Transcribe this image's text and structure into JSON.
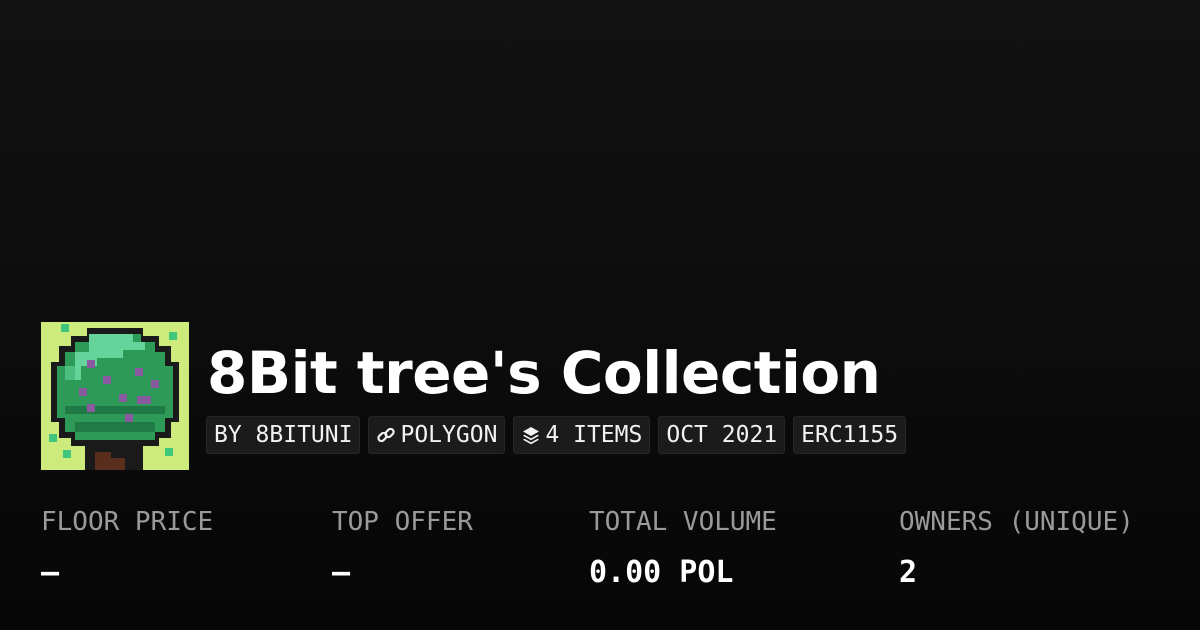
{
  "collection": {
    "title": "8Bit tree's Collection",
    "avatar_icon": "pixel-tree-icon",
    "avatar_colors": {
      "background": "#cdea7d",
      "leaf": "#2d9a57",
      "leaf_light": "#66d49a",
      "leaf_dark": "#1f7a45",
      "spot": "#8a5aa0",
      "trunk": "#5a2e1c",
      "outline": "#1a1a1a"
    }
  },
  "tags": {
    "creator": "BY 8BITUNI",
    "chain": "POLYGON",
    "chain_icon": "link-icon",
    "items": "4 ITEMS",
    "items_icon": "layers-icon",
    "date": "OCT 2021",
    "standard": "ERC1155"
  },
  "stats": {
    "floor_price": {
      "label": "FLOOR PRICE",
      "value": "–"
    },
    "top_offer": {
      "label": "TOP OFFER",
      "value": "–"
    },
    "total_volume": {
      "label": "TOTAL VOLUME",
      "value": "0.00 POL"
    },
    "owners": {
      "label": "OWNERS (UNIQUE)",
      "value": "2"
    }
  }
}
